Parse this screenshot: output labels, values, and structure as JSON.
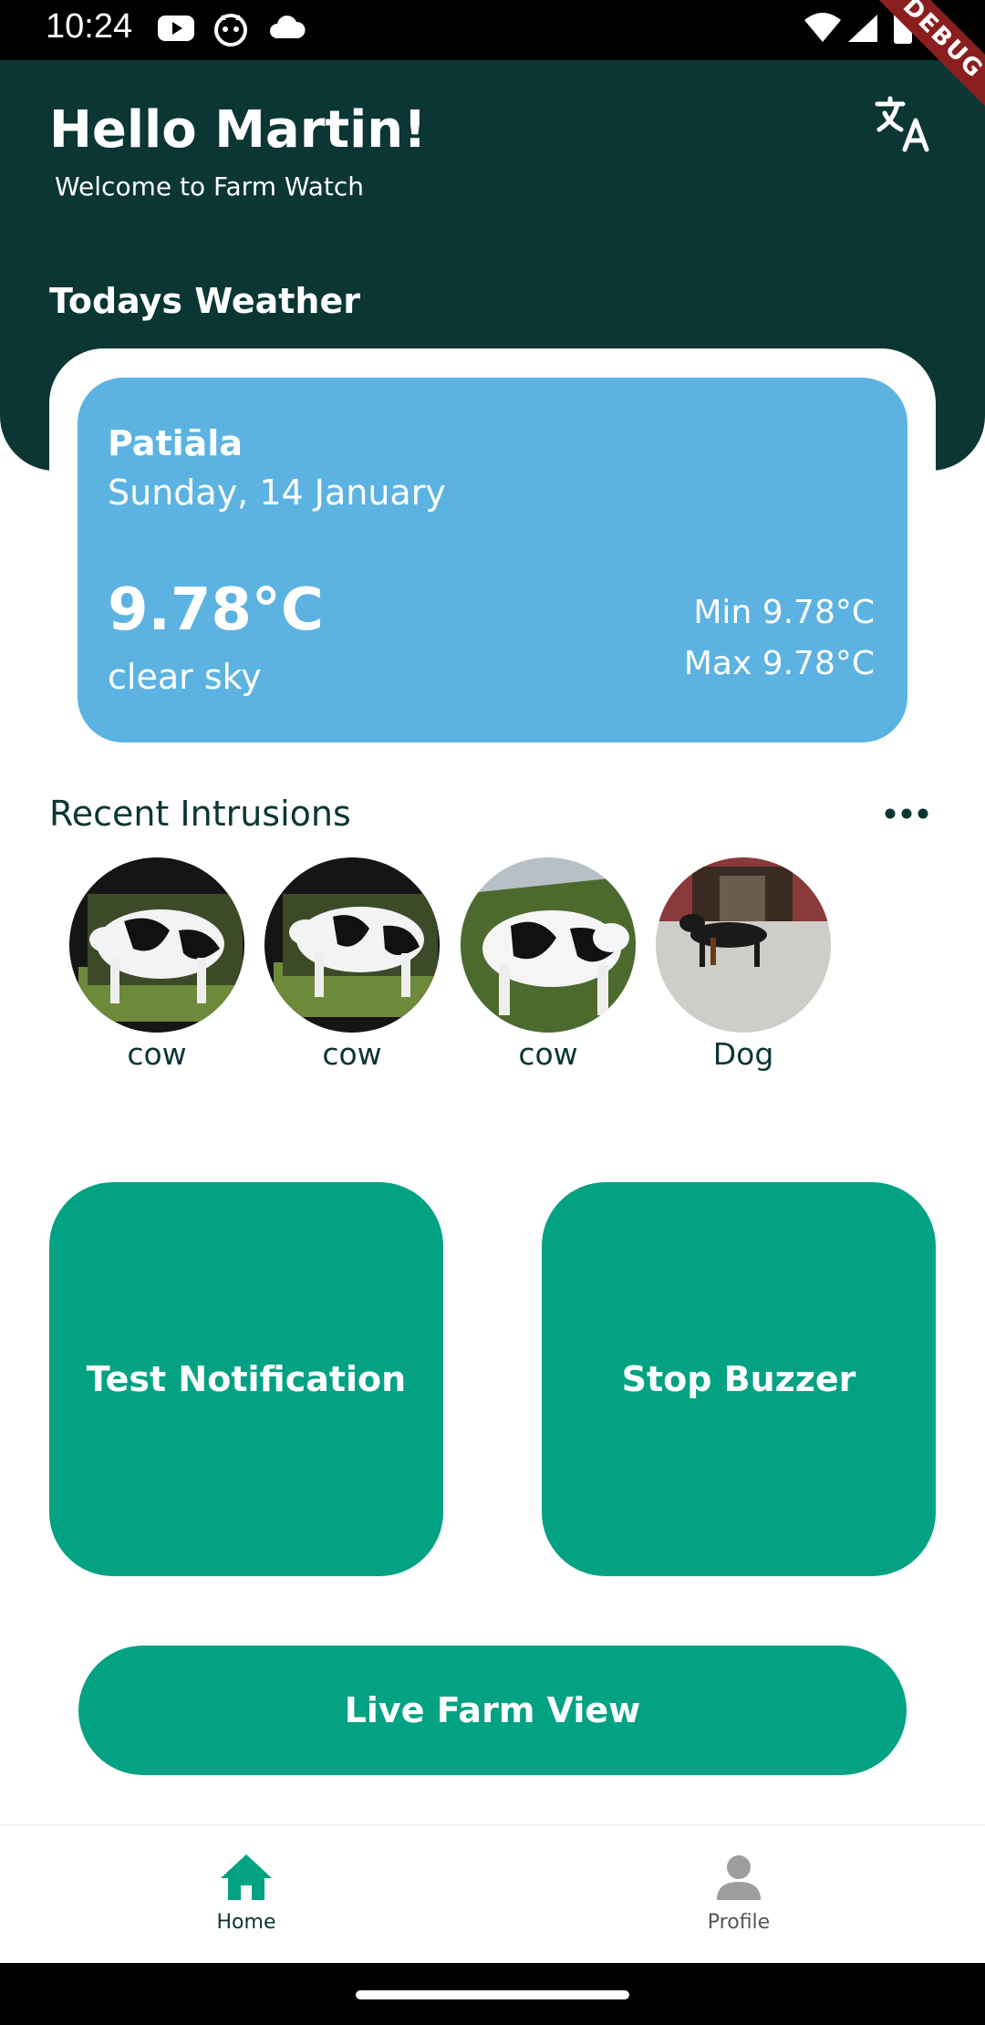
{
  "status_bar": {
    "time": "10:24",
    "left_icons": [
      "youtube-icon",
      "cat-icon",
      "cloud-icon"
    ],
    "right_icons": [
      "wifi-icon",
      "signal-icon",
      "battery-icon"
    ],
    "debug_banner": "DEBUG"
  },
  "header": {
    "greeting": "Hello Martin!",
    "subtitle": "Welcome to Farm Watch",
    "translate_icon": "translate-icon",
    "weather_heading": "Todays Weather"
  },
  "weather": {
    "city": "Patiāla",
    "date": "Sunday, 14 January",
    "temperature": "9.78°C",
    "condition": "clear sky",
    "min": "Min 9.78°C",
    "max": "Max 9.78°C"
  },
  "intrusions": {
    "title": "Recent Intrusions",
    "more_icon": "more-horizontal-icon",
    "items": [
      {
        "label": "cow"
      },
      {
        "label": "cow"
      },
      {
        "label": "cow"
      },
      {
        "label": "Dog"
      }
    ]
  },
  "actions": {
    "test_notification": "Test Notification",
    "stop_buzzer": "Stop Buzzer",
    "live_farm_view": "Live Farm View"
  },
  "bottom_nav": {
    "items": [
      {
        "label": "Home",
        "icon": "home-icon",
        "active": true
      },
      {
        "label": "Profile",
        "icon": "person-icon",
        "active": false
      }
    ]
  },
  "colors": {
    "header_bg": "#0b3634",
    "weather_card": "#5cb3e2",
    "accent": "#02a283",
    "inactive": "#9e9e9e"
  }
}
